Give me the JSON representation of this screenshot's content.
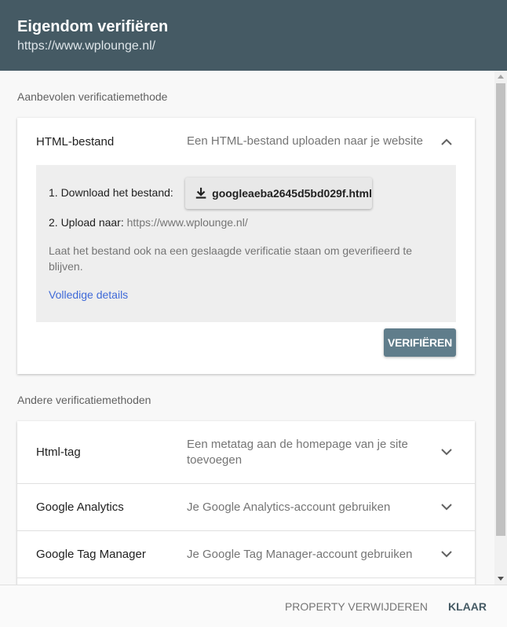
{
  "header": {
    "title": "Eigendom verifiëren",
    "subtitle": "https://www.wplounge.nl/"
  },
  "recommended": {
    "label": "Aanbevolen verificatiemethode",
    "method": {
      "name": "HTML-bestand",
      "description": "Een HTML-bestand uploaden naar je website",
      "expanded": true,
      "step1_label": "1. Download het bestand:",
      "download_file": "googleaeba2645d5bd029f.html",
      "step2_label": "2. Upload naar:",
      "step2_url": "https://www.wplounge.nl/",
      "note": "Laat het bestand ook na een geslaagde verificatie staan om geverifieerd te blijven.",
      "details_link": "Volledige details",
      "verify_button": "VERIFIËREN"
    }
  },
  "others": {
    "label": "Andere verificatiemethoden",
    "methods": [
      {
        "name": "Html-tag",
        "description": "Een metatag aan de homepage van je site toevoegen"
      },
      {
        "name": "Google Analytics",
        "description": "Je Google Analytics-account gebruiken"
      },
      {
        "name": "Google Tag Manager",
        "description": "Je Google Tag Manager-account gebruiken"
      }
    ]
  },
  "footer": {
    "remove_button": "PROPERTY VERWIJDEREN",
    "done_button": "KLAAR"
  },
  "colors": {
    "header_bg": "#455a64",
    "verify_button_bg": "#607d8b",
    "link": "#3f6ad8"
  }
}
